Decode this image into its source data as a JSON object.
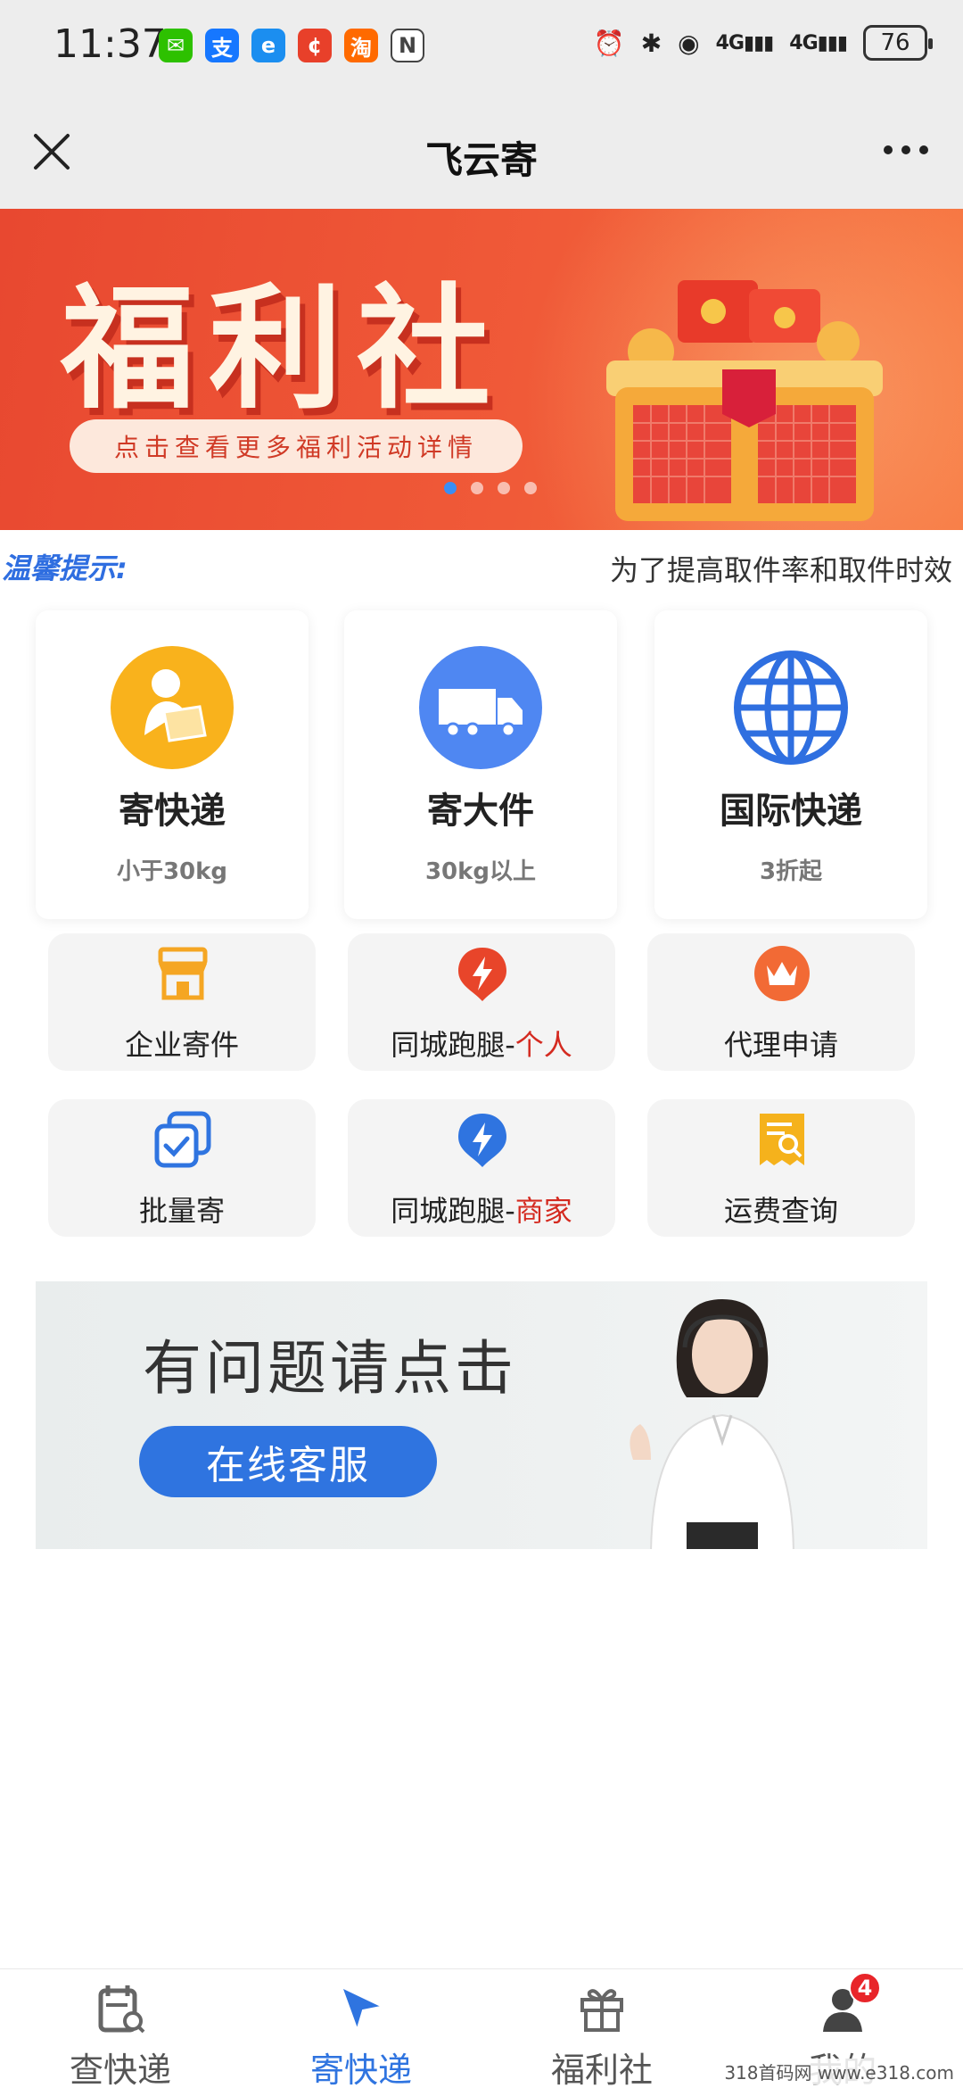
{
  "status_bar": {
    "time": "11:37",
    "app_icons": [
      {
        "name": "wechat-icon",
        "glyph": "✉",
        "color": "#2dc100"
      },
      {
        "name": "alipay-icon",
        "glyph": "支",
        "color": "#1677ff"
      },
      {
        "name": "browser-icon",
        "glyph": "e",
        "color": "#1b8ef0"
      },
      {
        "name": "shop-icon",
        "glyph": "¢",
        "color": "#e8402a"
      },
      {
        "name": "taobao-icon",
        "glyph": "淘",
        "color": "#ff6a00"
      },
      {
        "name": "nfc-icon",
        "glyph": "N",
        "color": "#444444"
      }
    ],
    "signal_1": "4G",
    "signal_2": "4G",
    "battery": "76"
  },
  "nav": {
    "title": "飞云寄"
  },
  "banner": {
    "title": "福利社",
    "subtitle": "点击查看更多福利活动详情",
    "dots": 4,
    "active_dot": 0
  },
  "notice": {
    "label": "温馨提示:",
    "text": "为了提高取件率和取件时效"
  },
  "services": [
    {
      "title": "寄快递",
      "sub": "小于30kg",
      "color": "#f9b21c"
    },
    {
      "title": "寄大件",
      "sub": "30kg以上",
      "color": "#4f87f2"
    },
    {
      "title": "国际快递",
      "sub": "3折起",
      "color": "#2f6fe0"
    }
  ],
  "tiles": [
    {
      "label": "企业寄件",
      "highlight": ""
    },
    {
      "label": "同城跑腿-",
      "highlight": "个人"
    },
    {
      "label": "代理申请",
      "highlight": ""
    },
    {
      "label": "批量寄",
      "highlight": ""
    },
    {
      "label": "同城跑腿-",
      "highlight": "商家"
    },
    {
      "label": "运费查询",
      "highlight": ""
    }
  ],
  "service_ad": {
    "title": "有问题请点击",
    "button": "在线客服"
  },
  "tabs": [
    {
      "label": "查快递",
      "active": false
    },
    {
      "label": "寄快递",
      "active": true
    },
    {
      "label": "福利社",
      "active": false
    },
    {
      "label": "我的",
      "active": false
    }
  ],
  "badge_count": "4",
  "watermark": "318首码网  www.e318.com",
  "colors": {
    "accent": "#2f74e0",
    "highlight": "#d42a20",
    "banner": "#e84830"
  }
}
